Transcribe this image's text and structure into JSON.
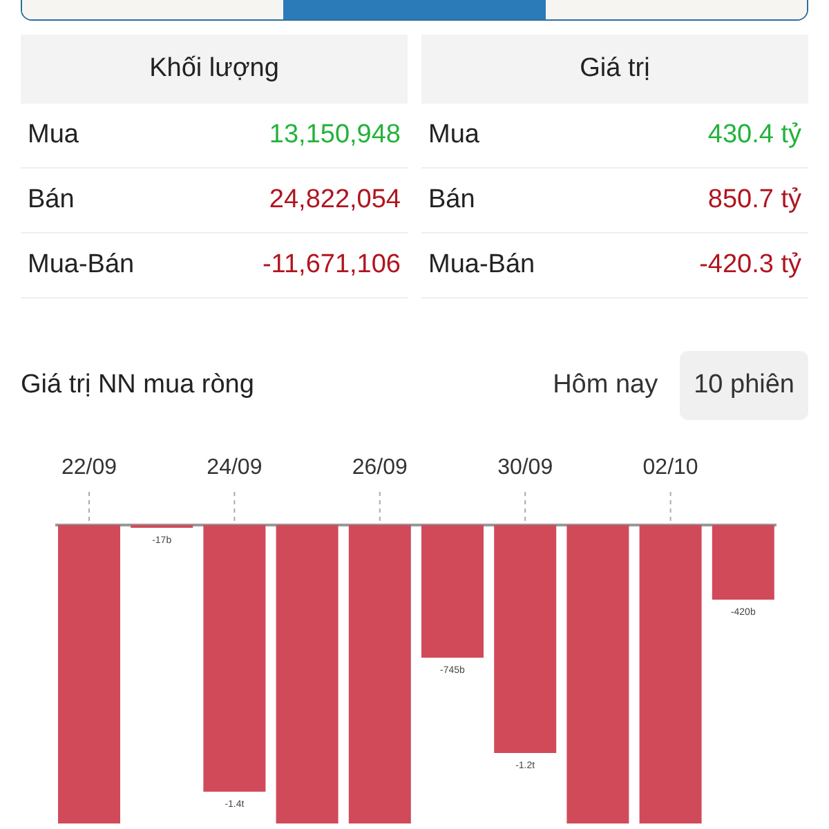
{
  "tabs": [
    {
      "selected": false
    },
    {
      "selected": true
    },
    {
      "selected": false
    }
  ],
  "summary": [
    {
      "header": "Khối lượng",
      "rows": [
        {
          "label": "Mua",
          "value": "13,150,948",
          "kind": "buy"
        },
        {
          "label": "Bán",
          "value": "24,822,054",
          "kind": "sell"
        },
        {
          "label": "Mua-Bán",
          "value": "-11,671,106",
          "kind": "sell"
        }
      ]
    },
    {
      "header": "Giá trị",
      "rows": [
        {
          "label": "Mua",
          "value": "430.4 tỷ",
          "kind": "buy"
        },
        {
          "label": "Bán",
          "value": "850.7 tỷ",
          "kind": "sell"
        },
        {
          "label": "Mua-Bán",
          "value": "-420.3 tỷ",
          "kind": "sell"
        }
      ]
    }
  ],
  "section_title": "Giá trị NN mua ròng",
  "periods": [
    {
      "label": "Hôm nay",
      "selected": false
    },
    {
      "label": "10 phiên",
      "selected": true
    }
  ],
  "chart": {
    "date_labels": [
      "22/09",
      "24/09",
      "26/09",
      "30/09",
      "02/10"
    ],
    "bar_value_labels": [
      "-17b",
      "-1.4t",
      "-745b",
      "-1.2t",
      "-420b"
    ]
  }
}
